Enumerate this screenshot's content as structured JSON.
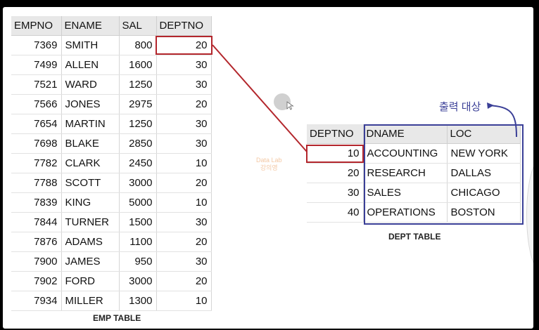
{
  "emp_table": {
    "columns": [
      "EMPNO",
      "ENAME",
      "SAL",
      "DEPTNO"
    ],
    "rows": [
      [
        "7369",
        "SMITH",
        "800",
        "20"
      ],
      [
        "7499",
        "ALLEN",
        "1600",
        "30"
      ],
      [
        "7521",
        "WARD",
        "1250",
        "30"
      ],
      [
        "7566",
        "JONES",
        "2975",
        "20"
      ],
      [
        "7654",
        "MARTIN",
        "1250",
        "30"
      ],
      [
        "7698",
        "BLAKE",
        "2850",
        "30"
      ],
      [
        "7782",
        "CLARK",
        "2450",
        "10"
      ],
      [
        "7788",
        "SCOTT",
        "3000",
        "20"
      ],
      [
        "7839",
        "KING",
        "5000",
        "10"
      ],
      [
        "7844",
        "TURNER",
        "1500",
        "30"
      ],
      [
        "7876",
        "ADAMS",
        "1100",
        "20"
      ],
      [
        "7900",
        "JAMES",
        "950",
        "30"
      ],
      [
        "7902",
        "FORD",
        "3000",
        "20"
      ],
      [
        "7934",
        "MILLER",
        "1300",
        "10"
      ]
    ],
    "caption": "EMP TABLE"
  },
  "dept_table": {
    "columns": [
      "DEPTNO",
      "DNAME",
      "LOC"
    ],
    "rows": [
      [
        "10",
        "ACCOUNTING",
        "NEW  YORK"
      ],
      [
        "20",
        "RESEARCH",
        "DALLAS"
      ],
      [
        "30",
        "SALES",
        "CHICAGO"
      ],
      [
        "40",
        "OPERATIONS",
        "BOSTON"
      ]
    ],
    "caption": "DEPT TABLE"
  },
  "annotation": {
    "output_label": "출력 대상"
  },
  "watermark": {
    "line1": "Data Lab",
    "line2": "강의영"
  },
  "colors": {
    "highlight_red": "#b3262c",
    "highlight_blue": "#3a3f97",
    "header_bg": "#e8e8e8"
  }
}
